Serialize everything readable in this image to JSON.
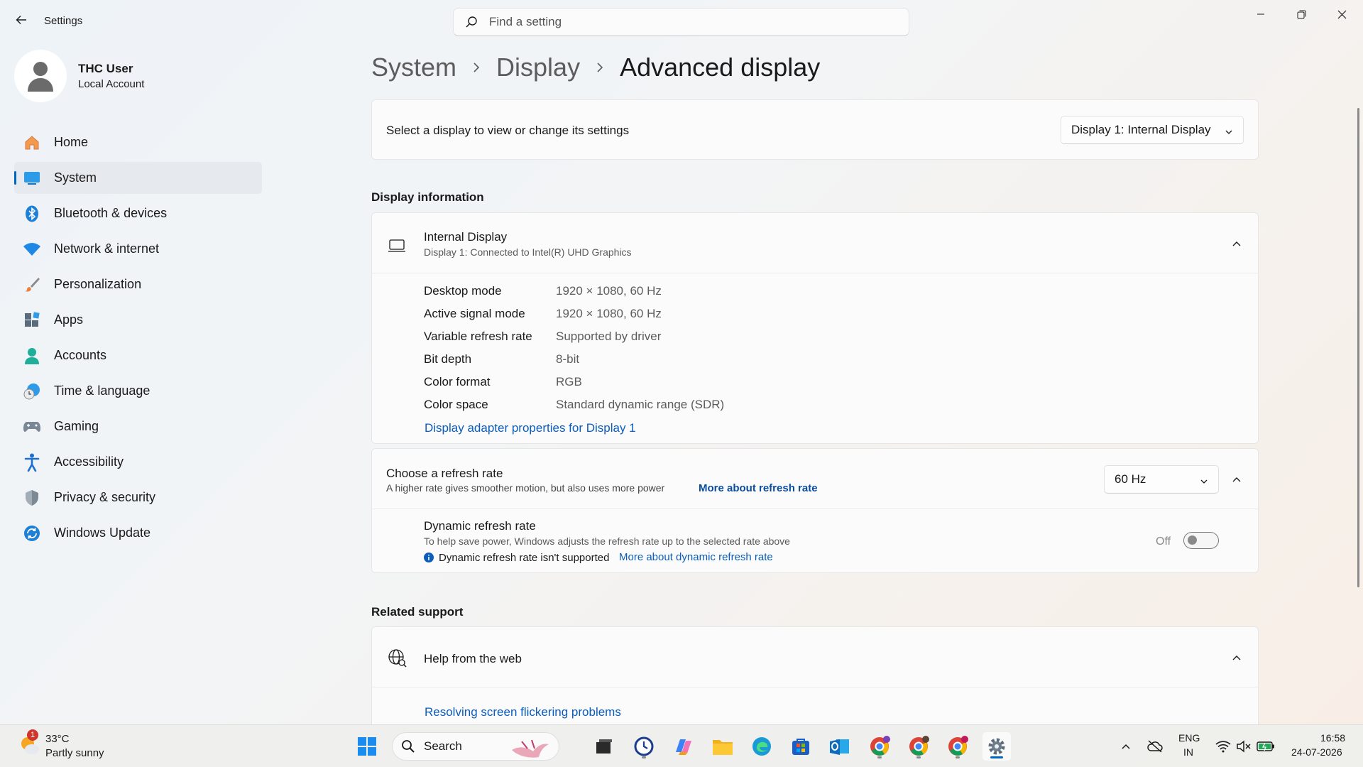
{
  "window": {
    "app_title": "Settings",
    "search_placeholder": "Find a setting"
  },
  "profile": {
    "name": "THC User",
    "account_type": "Local Account"
  },
  "sidebar": {
    "items": [
      {
        "label": "Home",
        "icon": "home-icon",
        "active": false
      },
      {
        "label": "System",
        "icon": "system-icon",
        "active": true
      },
      {
        "label": "Bluetooth & devices",
        "icon": "bluetooth-icon",
        "active": false
      },
      {
        "label": "Network & internet",
        "icon": "wifi-icon",
        "active": false
      },
      {
        "label": "Personalization",
        "icon": "brush-icon",
        "active": false
      },
      {
        "label": "Apps",
        "icon": "apps-icon",
        "active": false
      },
      {
        "label": "Accounts",
        "icon": "accounts-icon",
        "active": false
      },
      {
        "label": "Time & language",
        "icon": "clock-globe-icon",
        "active": false
      },
      {
        "label": "Gaming",
        "icon": "gamepad-icon",
        "active": false
      },
      {
        "label": "Accessibility",
        "icon": "accessibility-icon",
        "active": false
      },
      {
        "label": "Privacy & security",
        "icon": "shield-icon",
        "active": false
      },
      {
        "label": "Windows Update",
        "icon": "update-icon",
        "active": false
      }
    ]
  },
  "breadcrumb": {
    "items": [
      "System",
      "Display",
      "Advanced display"
    ]
  },
  "display_select": {
    "label": "Select a display to view or change its settings",
    "selected": "Display 1: Internal Display"
  },
  "display_info": {
    "section_title": "Display information",
    "device_name": "Internal Display",
    "device_sub": "Display 1: Connected to Intel(R) UHD Graphics",
    "rows": [
      {
        "label": "Desktop mode",
        "value": "1920 × 1080, 60 Hz"
      },
      {
        "label": "Active signal mode",
        "value": "1920 × 1080, 60 Hz"
      },
      {
        "label": "Variable refresh rate",
        "value": "Supported by driver"
      },
      {
        "label": "Bit depth",
        "value": "8-bit"
      },
      {
        "label": "Color format",
        "value": "RGB"
      },
      {
        "label": "Color space",
        "value": "Standard dynamic range (SDR)"
      }
    ],
    "adapter_link": "Display adapter properties for Display 1"
  },
  "refresh_rate": {
    "title": "Choose a refresh rate",
    "description": "A higher rate gives smoother motion, but also uses more power",
    "more_link": "More about refresh rate",
    "selected": "60 Hz",
    "dynamic": {
      "title": "Dynamic refresh rate",
      "description": "To help save power, Windows adjusts the refresh rate up to the selected rate above",
      "warning": "Dynamic refresh rate isn't supported",
      "more_link": "More about dynamic refresh rate",
      "toggle_state": "Off"
    }
  },
  "related_support": {
    "section_title": "Related support",
    "help_title": "Help from the web",
    "link": "Resolving screen flickering problems"
  },
  "taskbar": {
    "weather_temp": "33°C",
    "weather_desc": "Partly sunny",
    "weather_badge": "1",
    "search_label": "Search",
    "lang_top": "ENG",
    "lang_bottom": "IN",
    "time": "16:58",
    "date": "24-07-2026"
  },
  "colors": {
    "accent": "#0067c0",
    "link": "#0a5cbd"
  }
}
